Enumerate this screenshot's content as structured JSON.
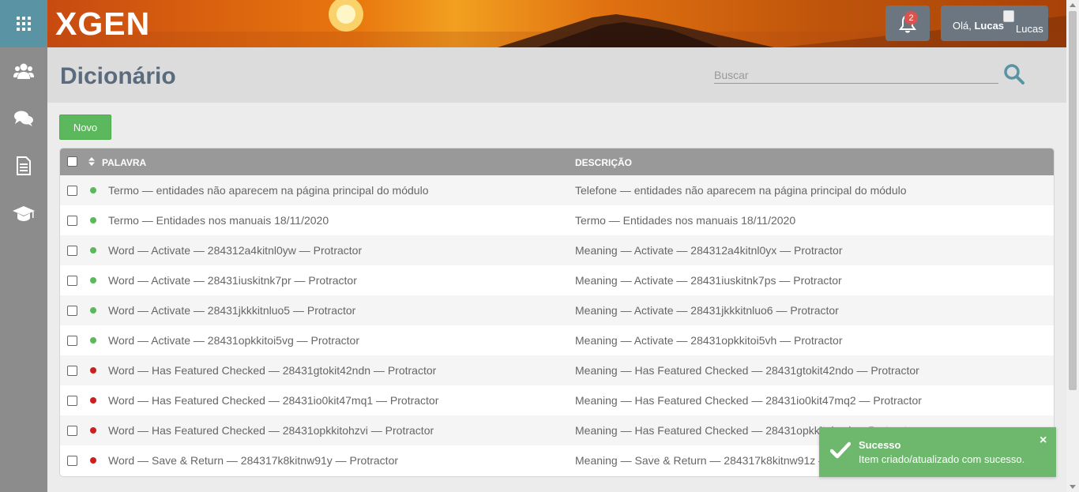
{
  "header": {
    "logo": "XGEN",
    "notifications_count": "2",
    "greeting": "Olá,",
    "user_name": "Lucas",
    "avatar_alt": "Lucas"
  },
  "sidebar": {
    "items": [
      {
        "icon": "grid-menu-icon"
      },
      {
        "icon": "users-icon"
      },
      {
        "icon": "chat-icon"
      },
      {
        "icon": "document-icon"
      },
      {
        "icon": "graduation-cap-icon"
      }
    ]
  },
  "page": {
    "title": "Dicionário",
    "search_placeholder": "Buscar",
    "new_button": "Novo"
  },
  "table": {
    "headers": [
      "PALAVRA",
      "DESCRIÇÃO"
    ],
    "rows": [
      {
        "status": "green",
        "palavra": "Termo — entidades não aparecem na página principal do módulo",
        "descricao": "Telefone — entidades não aparecem na página principal do módulo"
      },
      {
        "status": "green",
        "palavra": "Termo — Entidades nos manuais 18/11/2020",
        "descricao": "Termo — Entidades nos manuais 18/11/2020"
      },
      {
        "status": "green",
        "palavra": "Word — Activate — 284312a4kitnl0yw — Protractor",
        "descricao": "Meaning — Activate — 284312a4kitnl0yx — Protractor"
      },
      {
        "status": "green",
        "palavra": "Word — Activate — 28431iuskitnk7pr — Protractor",
        "descricao": "Meaning — Activate — 28431iuskitnk7ps — Protractor"
      },
      {
        "status": "green",
        "palavra": "Word — Activate — 28431jkkkitnluo5 — Protractor",
        "descricao": "Meaning — Activate — 28431jkkkitnluo6 — Protractor"
      },
      {
        "status": "green",
        "palavra": "Word — Activate — 28431opkkitoi5vg — Protractor",
        "descricao": "Meaning — Activate — 28431opkkitoi5vh — Protractor"
      },
      {
        "status": "red",
        "palavra": "Word — Has Featured Checked — 28431gtokit42ndn — Protractor",
        "descricao": "Meaning — Has Featured Checked — 28431gtokit42ndo — Protractor"
      },
      {
        "status": "red",
        "palavra": "Word — Has Featured Checked — 28431io0kit47mq1 — Protractor",
        "descricao": "Meaning — Has Featured Checked — 28431io0kit47mq2 — Protractor"
      },
      {
        "status": "red",
        "palavra": "Word — Has Featured Checked — 28431opkkitohzvi — Protractor",
        "descricao": "Meaning — Has Featured Checked — 28431opkkitohzvj — Protractor"
      },
      {
        "status": "red",
        "palavra": "Word — Save & Return — 284317k8kitnw91y — Protractor",
        "descricao": "Meaning — Save & Return — 284317k8kitnw91z — Protractor"
      }
    ]
  },
  "toast": {
    "title": "Sucesso",
    "message": "Item criado/atualizado com sucesso.",
    "close": "×"
  },
  "colors": {
    "green": "#5cb85c",
    "red": "#cc1f1f",
    "menu_accent": "#5a93a3",
    "toast": "#6db86d"
  }
}
